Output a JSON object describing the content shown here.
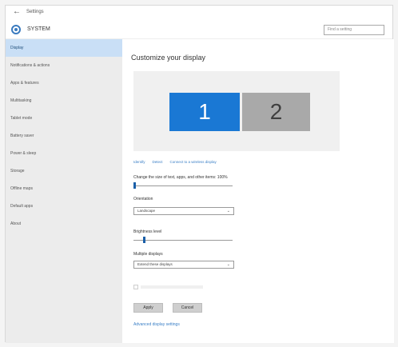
{
  "titlebar": {
    "back": "←",
    "title": "Settings"
  },
  "header": {
    "title": "SYSTEM",
    "search_placeholder": "Find a setting"
  },
  "sidebar": {
    "items": [
      {
        "label": "Display",
        "active": true
      },
      {
        "label": "Notifications & actions",
        "active": false
      },
      {
        "label": "Apps & features",
        "active": false
      },
      {
        "label": "Multitasking",
        "active": false
      },
      {
        "label": "Tablet mode",
        "active": false
      },
      {
        "label": "Battery saver",
        "active": false
      },
      {
        "label": "Power & sleep",
        "active": false
      },
      {
        "label": "Storage",
        "active": false
      },
      {
        "label": "Offline maps",
        "active": false
      },
      {
        "label": "Default apps",
        "active": false
      },
      {
        "label": "About",
        "active": false
      }
    ]
  },
  "main": {
    "title": "Customize your display",
    "monitors": [
      "1",
      "2"
    ],
    "links": [
      "Identify",
      "Detect",
      "Connect to a wireless display"
    ],
    "scale": {
      "label": "Change the size of text, apps, and other items: 100%",
      "value": 0
    },
    "orientation": {
      "label": "Orientation",
      "value": "Landscape"
    },
    "brightness": {
      "label": "Brightness level",
      "value": 0.1
    },
    "multiple": {
      "label": "Multiple displays",
      "value": "Extend these displays"
    },
    "apply": "Apply",
    "cancel": "Cancel",
    "advanced": "Advanced display settings"
  },
  "colors": {
    "accent": "#1a78d4",
    "sidebar_active": "#c9dff6",
    "link": "#3a7fc6"
  }
}
